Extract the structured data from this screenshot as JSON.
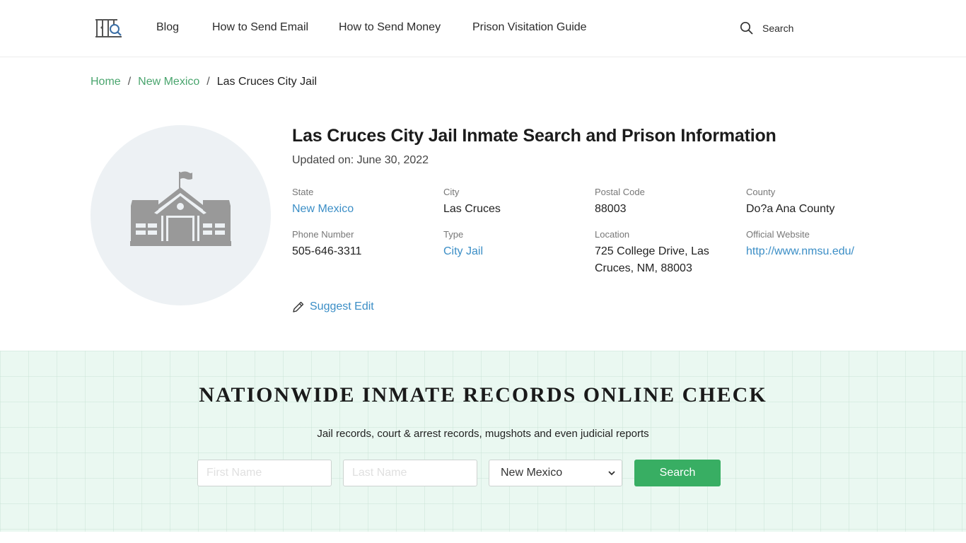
{
  "header": {
    "logo_icon": "prison-bars-magnifier-icon",
    "nav": [
      {
        "label": "Blog"
      },
      {
        "label": "How to Send Email"
      },
      {
        "label": "How to Send Money"
      },
      {
        "label": "Prison Visitation Guide"
      }
    ],
    "search_label": "Search",
    "search_icon": "search-icon"
  },
  "breadcrumb": {
    "items": [
      {
        "label": "Home"
      },
      {
        "label": "New Mexico"
      }
    ],
    "separator": "/",
    "current": "Las Cruces City Jail"
  },
  "facility": {
    "image_icon": "building-with-flag-icon",
    "title": "Las Cruces City Jail Inmate Search and Prison Information",
    "updated": "Updated on: June 30, 2022",
    "fields": [
      {
        "label": "State",
        "value": "New Mexico",
        "link": true
      },
      {
        "label": "City",
        "value": "Las Cruces",
        "link": false
      },
      {
        "label": "Postal Code",
        "value": "88003",
        "link": false
      },
      {
        "label": "County",
        "value": "Do?a Ana County",
        "link": false
      },
      {
        "label": "Phone Number",
        "value": "505-646-3311",
        "link": false
      },
      {
        "label": "Type",
        "value": "City Jail",
        "link": true
      },
      {
        "label": "Location",
        "value": "725 College Drive, Las Cruces, NM, 88003",
        "link": false
      },
      {
        "label": "Official Website",
        "value": "http://www.nmsu.edu/",
        "link": true
      }
    ],
    "suggest_edit": "Suggest Edit"
  },
  "banner": {
    "title": "NATIONWIDE INMATE RECORDS ONLINE CHECK",
    "subtitle": "Jail records, court & arrest records, mugshots and even judicial reports",
    "first_name_placeholder": "First Name",
    "first_name_value": "",
    "last_name_placeholder": "Last Name",
    "last_name_value": "",
    "state_selected": "New Mexico",
    "search_button": "Search",
    "button_color": "#38ae63"
  }
}
